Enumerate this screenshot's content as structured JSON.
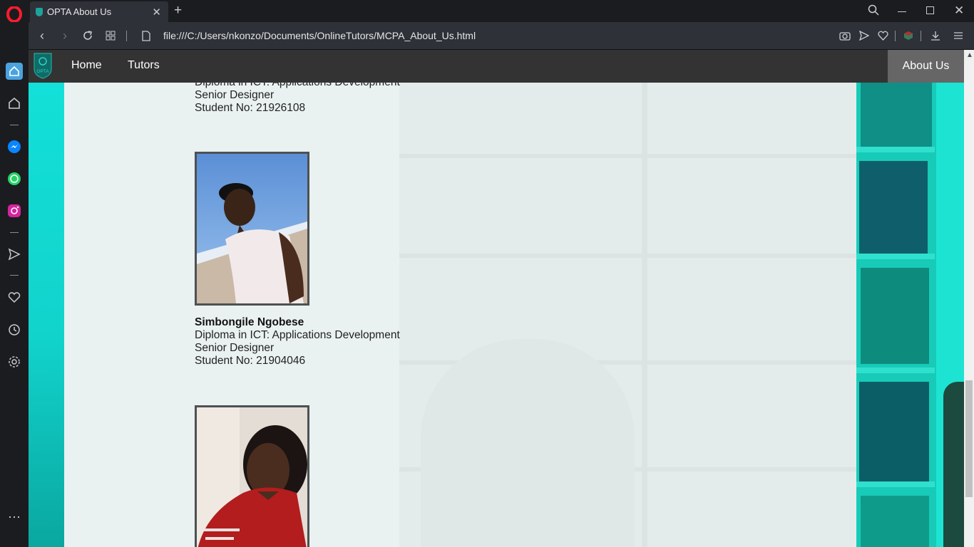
{
  "browser": {
    "tab_title": "OPTA About Us",
    "url": "file:///C:/Users/nkonzo/Documents/OnlineTutors/MCPA_About_Us.html"
  },
  "navbar": {
    "logo_text": "OPTA",
    "links": [
      "Home",
      "Tutors"
    ],
    "active": "About Us"
  },
  "members": [
    {
      "qualification": "Diploma in ICT: Applications Development",
      "role": "Senior Designer",
      "student_no": "Student No: 21926108"
    },
    {
      "name": "Simbongile Ngobese",
      "qualification": "Diploma in ICT: Applications Development",
      "role": "Senior Designer",
      "student_no": "Student No: 21904046"
    }
  ]
}
